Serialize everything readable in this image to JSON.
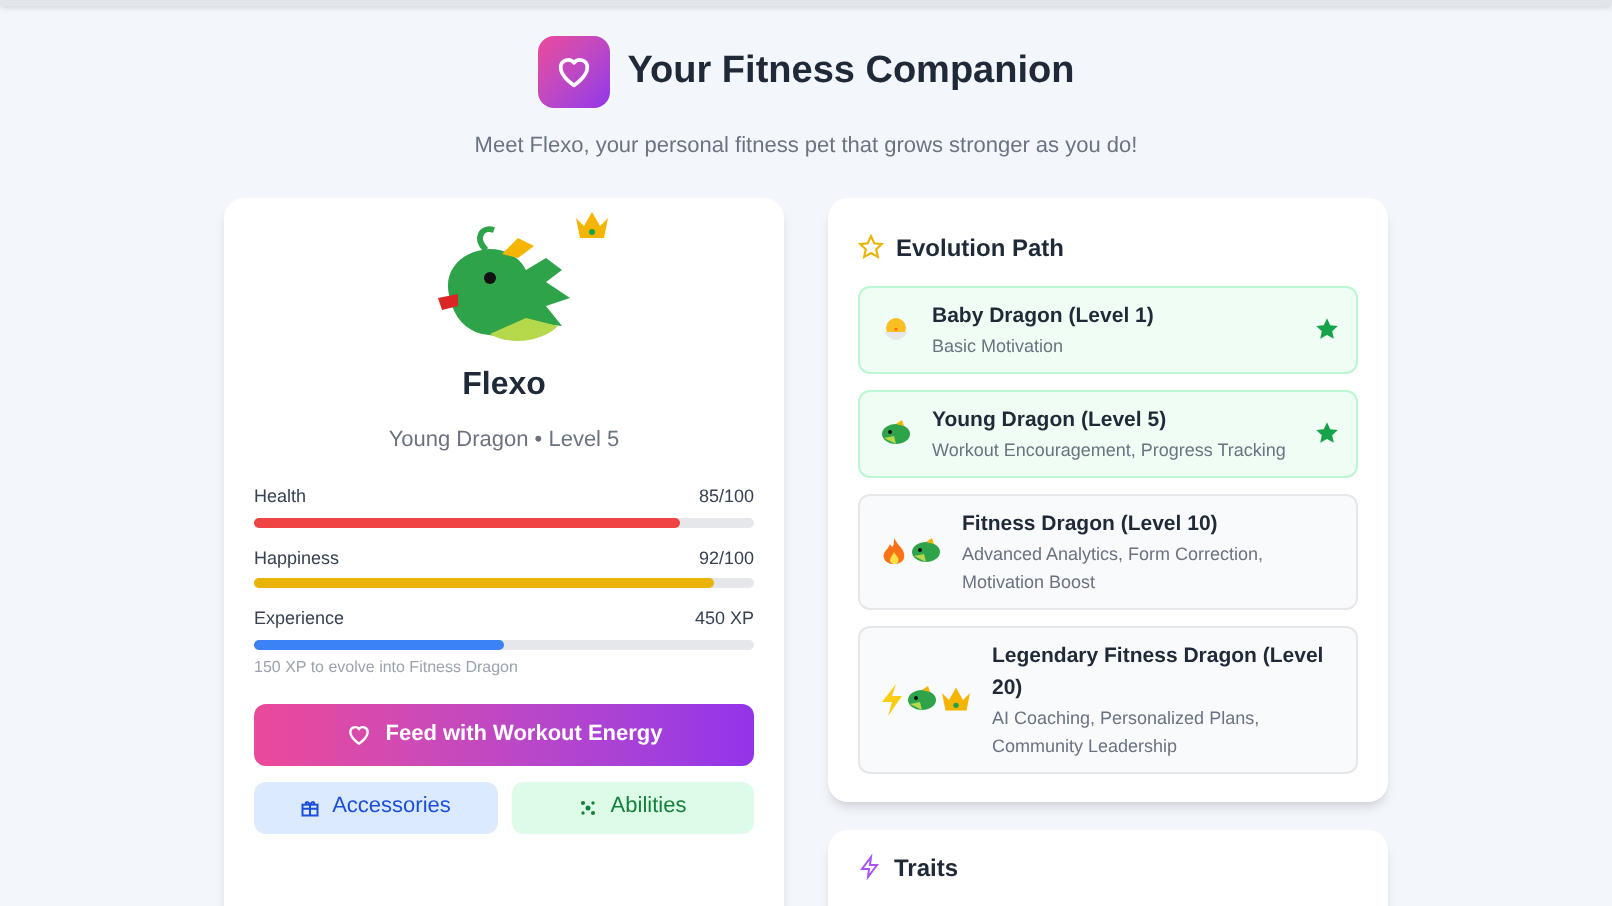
{
  "header": {
    "title": "Your Fitness Companion",
    "subtitle": "Meet Flexo, your personal fitness pet that grows stronger as you do!"
  },
  "pet": {
    "name": "Flexo",
    "description": "Young Dragon • Level 5",
    "stats": [
      {
        "label": "Health",
        "value": "85/100",
        "level": 0.85,
        "color": "#ef4444"
      },
      {
        "label": "Happiness",
        "value": "92/100",
        "level": 0.92,
        "color": "#eab308"
      },
      {
        "label": "Experience",
        "value": "450 XP",
        "level": 0.5,
        "color": "#3b82f6"
      }
    ],
    "xp_note": "150 XP to evolve into Fitness Dragon",
    "feed_button": "Feed with Workout Energy",
    "buttons": [
      {
        "label": "Accessories",
        "kind": "accessories"
      },
      {
        "label": "Abilities",
        "kind": "abilities"
      }
    ]
  },
  "evolution": {
    "title": "Evolution Path",
    "stages": [
      {
        "name": "Baby Dragon (Level 1)",
        "features": "Basic Motivation",
        "unlocked": true
      },
      {
        "name": "Young Dragon (Level 5)",
        "features": "Workout Encouragement, Progress Tracking",
        "unlocked": true
      },
      {
        "name": "Fitness Dragon (Level 10)",
        "features": "Advanced Analytics, Form Correction, Motivation Boost",
        "unlocked": false
      },
      {
        "name": "Legendary Fitness Dragon (Level 20)",
        "features": "AI Coaching, Personalized Plans, Community Leadership",
        "unlocked": false
      }
    ]
  },
  "traits": {
    "title": "Traits"
  }
}
